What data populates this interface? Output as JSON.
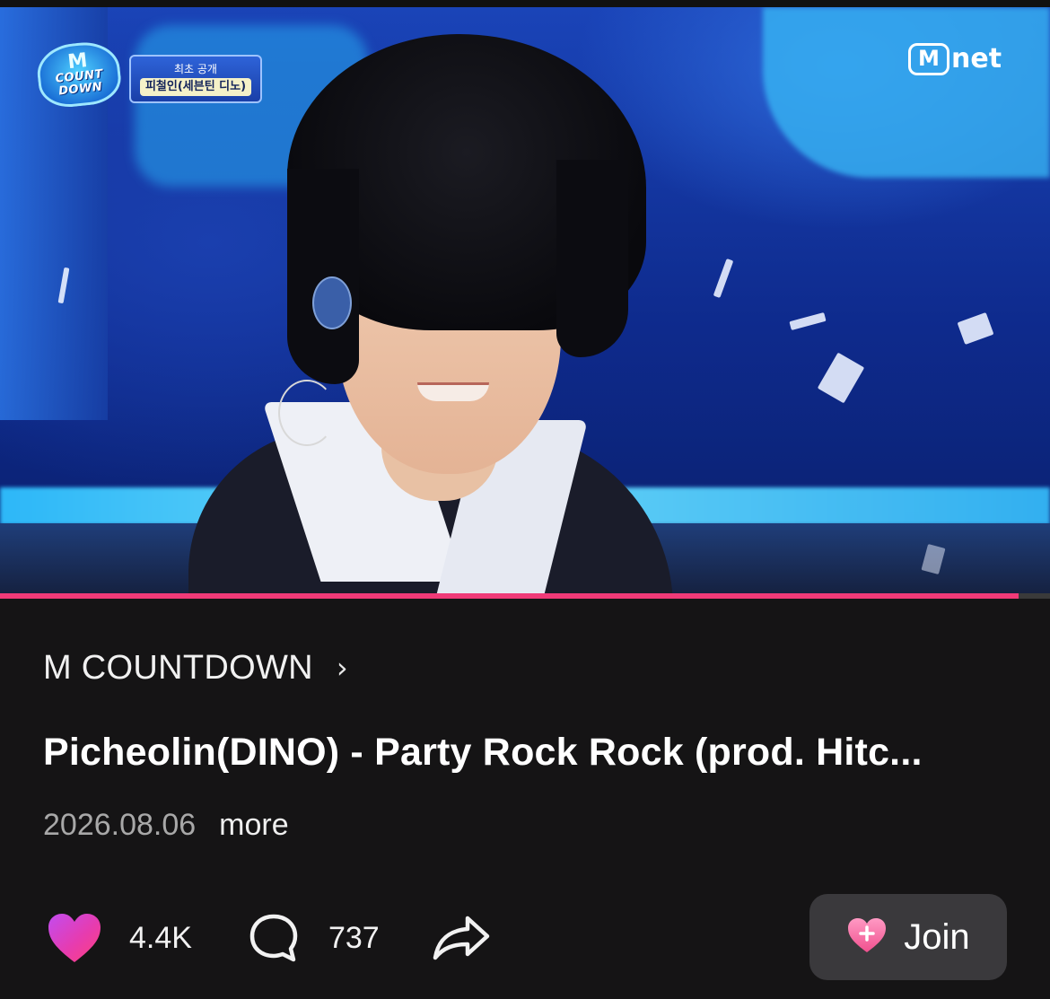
{
  "video": {
    "show_logo": {
      "line1": "M",
      "line2": "COUNT",
      "line3": "DOWN"
    },
    "badge": {
      "top": "최초 공개",
      "bottom": "피철인(세븐틴 디노)"
    },
    "broadcaster": {
      "m": "M",
      "net": "net"
    },
    "progress": 0.97,
    "progress_color": "#f03a78"
  },
  "channel": {
    "name": "M COUNTDOWN",
    "chevron_icon": "chevron-right-icon"
  },
  "title": "Picheolin(DINO) - Party Rock Rock (prod. Hitc...",
  "meta": {
    "date": "2026.08.06",
    "more_label": "more"
  },
  "actions": {
    "likes": "4.4K",
    "comments": "737",
    "like_icon": "heart-icon",
    "comment_icon": "comment-bubble-icon",
    "share_icon": "share-arrow-icon"
  },
  "join_button": {
    "label": "Join",
    "icon": "heart-plus-icon"
  },
  "colors": {
    "background": "#151415",
    "accent": "#f03a78",
    "join_bg": "#3a393c"
  }
}
